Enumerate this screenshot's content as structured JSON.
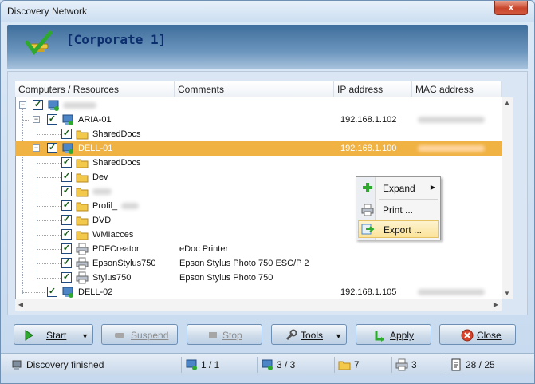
{
  "window": {
    "title": "Discovery Network",
    "close_glyph": "x"
  },
  "header": {
    "title": "[Corporate 1]"
  },
  "columns": [
    "Computers / Resources",
    "Comments",
    "IP address",
    "MAC address"
  ],
  "tree": [
    {
      "label": "",
      "comment": "",
      "ip": "",
      "mac": ""
    },
    {
      "label": "ARIA-01",
      "comment": "",
      "ip": "192.168.1.102",
      "mac": ""
    },
    {
      "label": "SharedDocs",
      "comment": "",
      "ip": "",
      "mac": ""
    },
    {
      "label": "DELL-01",
      "comment": "",
      "ip": "192.168.1.100",
      "mac": ""
    },
    {
      "label": "SharedDocs",
      "comment": "",
      "ip": "",
      "mac": ""
    },
    {
      "label": "Dev",
      "comment": "",
      "ip": "",
      "mac": ""
    },
    {
      "label": "",
      "comment": "",
      "ip": "",
      "mac": ""
    },
    {
      "label": "Profil_",
      "comment": "",
      "ip": "",
      "mac": ""
    },
    {
      "label": "DVD",
      "comment": "",
      "ip": "",
      "mac": ""
    },
    {
      "label": "WMIacces",
      "comment": "",
      "ip": "",
      "mac": ""
    },
    {
      "label": "PDFCreator",
      "comment": "eDoc Printer",
      "ip": "",
      "mac": ""
    },
    {
      "label": "EpsonStylus750",
      "comment": "Epson Stylus Photo 750 ESC/P 2",
      "ip": "",
      "mac": ""
    },
    {
      "label": "Stylus750",
      "comment": "Epson Stylus Photo 750",
      "ip": "",
      "mac": ""
    },
    {
      "label": "DELL-02",
      "comment": "",
      "ip": "192.168.1.105",
      "mac": ""
    }
  ],
  "context_menu": [
    {
      "label": "Expand",
      "icon": "plus-icon",
      "submenu": true
    },
    {
      "label": "Print ...",
      "icon": "printer-icon",
      "submenu": false
    },
    {
      "label": "Export ...",
      "icon": "export-icon",
      "submenu": false
    }
  ],
  "buttons": {
    "start": "Start",
    "suspend": "Suspend",
    "stop": "Stop",
    "tools": "Tools",
    "apply": "Apply",
    "close": "Close"
  },
  "status": {
    "message": "Discovery finished",
    "computers": "1 / 1",
    "hosts": "3 / 3",
    "folders": "7",
    "printers": "3",
    "total": "28 / 25"
  },
  "colors": {
    "selection": "#f0b243",
    "header_text": "#0c2d6e",
    "menu_highlight": "#fbe39a"
  }
}
